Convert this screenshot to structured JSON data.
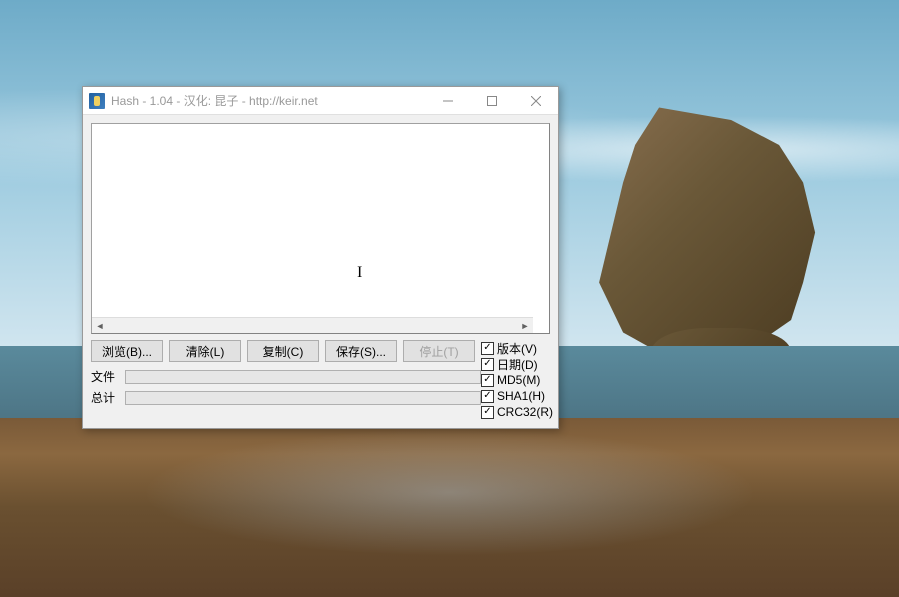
{
  "window": {
    "title": "Hash - 1.04 - 汉化: 昆子 - http://keir.net"
  },
  "buttons": {
    "browse": "浏览(B)...",
    "clear": "清除(L)",
    "copy": "复制(C)",
    "save": "保存(S)...",
    "stop": "停止(T)"
  },
  "checkboxes": {
    "version": {
      "label": "版本(V)",
      "checked": true
    },
    "date": {
      "label": "日期(D)",
      "checked": true
    },
    "md5": {
      "label": "MD5(M)",
      "checked": true
    },
    "sha1": {
      "label": "SHA1(H)",
      "checked": true
    },
    "crc32": {
      "label": "CRC32(R)",
      "checked": true
    }
  },
  "progress": {
    "file_label": "文件",
    "total_label": "总计"
  }
}
